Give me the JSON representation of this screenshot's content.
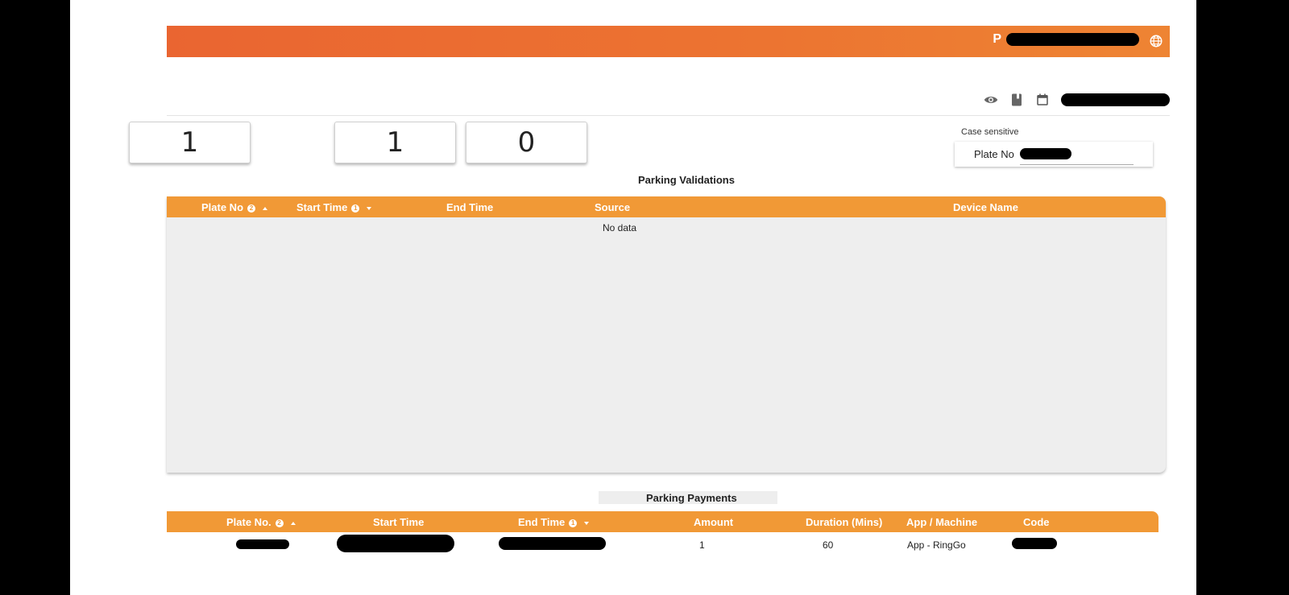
{
  "header": {
    "user_initial": "P"
  },
  "counters": [
    "1",
    "1",
    "0"
  ],
  "search": {
    "case_sensitive_label": "Case sensitive",
    "field_label": "Plate No"
  },
  "validations": {
    "title": "Parking Validations",
    "columns": {
      "plate_no": "Plate No",
      "plate_no_badge": "2",
      "start_time": "Start Time",
      "start_time_badge": "1",
      "end_time": "End Time",
      "source": "Source",
      "device_name": "Device Name"
    },
    "empty_text": "No data"
  },
  "payments": {
    "title": "Parking Payments",
    "columns": {
      "plate_no": "Plate No.",
      "plate_no_badge": "2",
      "start_time": "Start Time",
      "end_time": "End Time",
      "end_time_badge": "1",
      "amount": "Amount",
      "duration": "Duration (Mins)",
      "app_machine": "App / Machine",
      "code": "Code"
    },
    "rows": [
      {
        "amount": "1",
        "duration": "60",
        "app_machine": "App - RingGo"
      }
    ]
  },
  "colors": {
    "header_gradient_start": "#ea6531",
    "header_gradient_end": "#ee8433",
    "table_header": "#f19936",
    "table_body": "#eeeeee"
  },
  "icons": [
    "globe-icon",
    "eye-icon",
    "book-icon",
    "calendar-icon",
    "sort-asc-icon",
    "sort-desc-icon"
  ]
}
